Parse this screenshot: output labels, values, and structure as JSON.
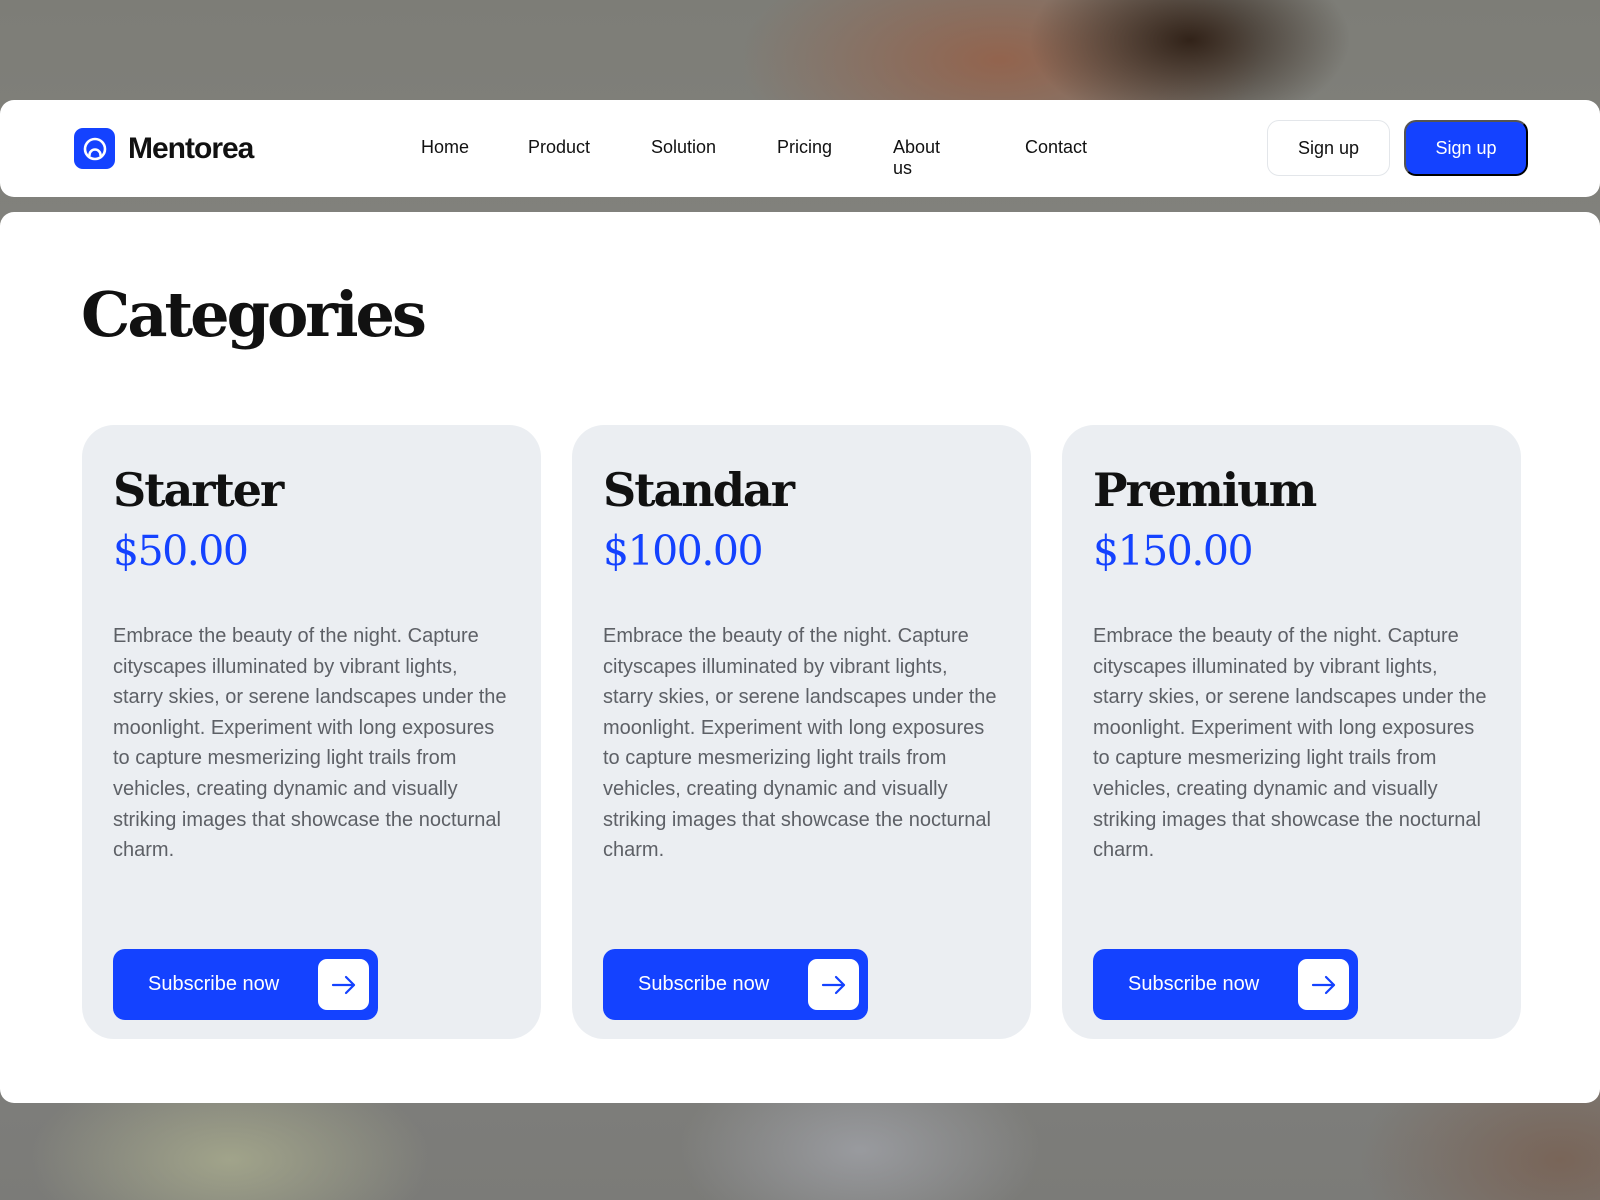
{
  "brand": {
    "name": "Mentorea",
    "logo_icon": "mentorea-logo-icon",
    "accent_color": "#1442ff"
  },
  "nav": {
    "links": [
      "Home",
      "Product",
      "Solution",
      "Pricing",
      "About us",
      "Contact"
    ]
  },
  "header_actions": {
    "outline_label": "Sign up",
    "primary_label": "Sign up"
  },
  "page": {
    "title": "Categories"
  },
  "cards": [
    {
      "name": "Starter",
      "price": "$50.00",
      "description": "Embrace the beauty of the night. Capture cityscapes illuminated by vibrant lights, starry skies, or serene landscapes under the moonlight. Experiment with long exposures to capture mesmerizing light trails from vehicles, creating dynamic and visually striking images that showcase the nocturnal charm.",
      "cta": "Subscribe now",
      "cta_icon": "arrow-right-icon"
    },
    {
      "name": "Standar",
      "price": "$100.00",
      "description": "Embrace the beauty of the night. Capture cityscapes illuminated by vibrant lights, starry skies, or serene landscapes under the moonlight. Experiment with long exposures to capture mesmerizing light trails from vehicles, creating dynamic and visually striking images that showcase the nocturnal charm.",
      "cta": "Subscribe now",
      "cta_icon": "arrow-right-icon"
    },
    {
      "name": "Premium",
      "price": "$150.00",
      "description": "Embrace the beauty of the night. Capture cityscapes illuminated by vibrant lights, starry skies, or serene landscapes under the moonlight. Experiment with long exposures to capture mesmerizing light trails from vehicles, creating dynamic and visually striking images that showcase the nocturnal charm.",
      "cta": "Subscribe now",
      "cta_icon": "arrow-right-icon"
    }
  ]
}
